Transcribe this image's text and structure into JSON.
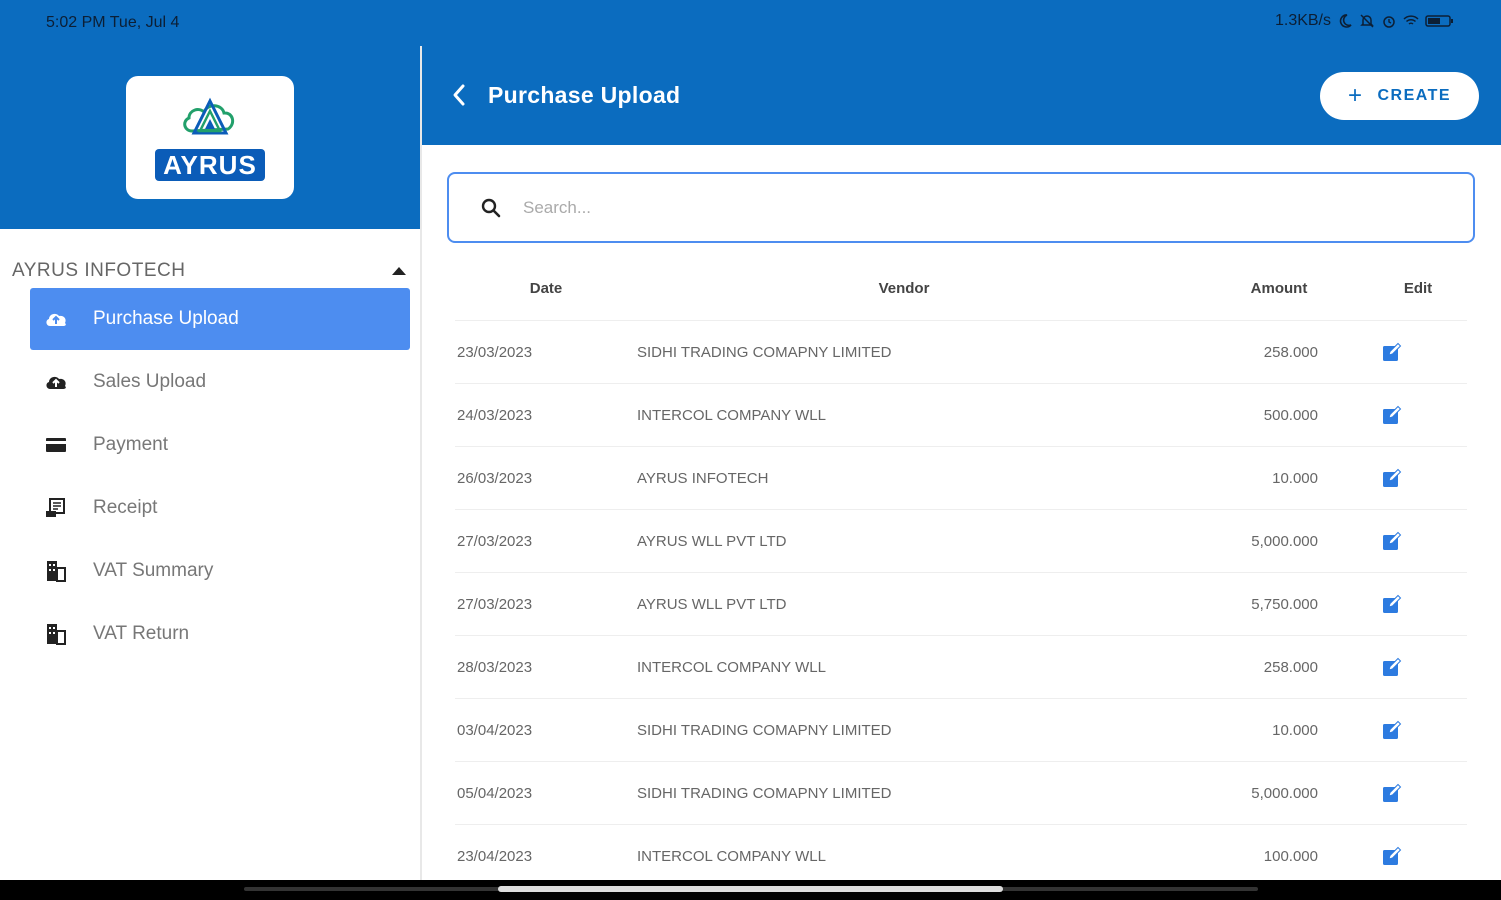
{
  "status_bar": {
    "time": "5:02 PM Tue, Jul 4",
    "net_speed": "1.3KB/s"
  },
  "brand": {
    "logo_text": "AYRUS",
    "accent": "#0b6cbf",
    "active_item": "#4d8df0"
  },
  "sidebar": {
    "company": "AYRUS INFOTECH",
    "items": [
      {
        "label": "Purchase Upload",
        "icon": "cloud-upload-icon",
        "active": true
      },
      {
        "label": "Sales Upload",
        "icon": "cloud-upload-icon",
        "active": false
      },
      {
        "label": "Payment",
        "icon": "credit-card-icon",
        "active": false
      },
      {
        "label": "Receipt",
        "icon": "receipt-icon",
        "active": false
      },
      {
        "label": "VAT Summary",
        "icon": "building-icon",
        "active": false
      },
      {
        "label": "VAT Return",
        "icon": "building-icon",
        "active": false
      }
    ]
  },
  "header": {
    "title": "Purchase Upload",
    "create_label": "CREATE"
  },
  "search": {
    "placeholder": "Search...",
    "value": ""
  },
  "table": {
    "columns": [
      "Date",
      "Vendor",
      "Amount",
      "Edit"
    ],
    "rows": [
      {
        "date": "23/03/2023",
        "vendor": "SIDHI TRADING COMAPNY LIMITED",
        "amount": "258.000"
      },
      {
        "date": "24/03/2023",
        "vendor": "INTERCOL COMPANY WLL",
        "amount": "500.000"
      },
      {
        "date": "26/03/2023",
        "vendor": "AYRUS INFOTECH",
        "amount": "10.000"
      },
      {
        "date": "27/03/2023",
        "vendor": "AYRUS WLL PVT LTD",
        "amount": "5,000.000"
      },
      {
        "date": "27/03/2023",
        "vendor": "AYRUS WLL PVT LTD",
        "amount": "5,750.000"
      },
      {
        "date": "28/03/2023",
        "vendor": "INTERCOL COMPANY WLL",
        "amount": "258.000"
      },
      {
        "date": "03/04/2023",
        "vendor": "SIDHI TRADING COMAPNY LIMITED",
        "amount": "10.000"
      },
      {
        "date": "05/04/2023",
        "vendor": "SIDHI TRADING COMAPNY LIMITED",
        "amount": "5,000.000"
      },
      {
        "date": "23/04/2023",
        "vendor": "INTERCOL COMPANY WLL",
        "amount": "100.000"
      }
    ]
  }
}
